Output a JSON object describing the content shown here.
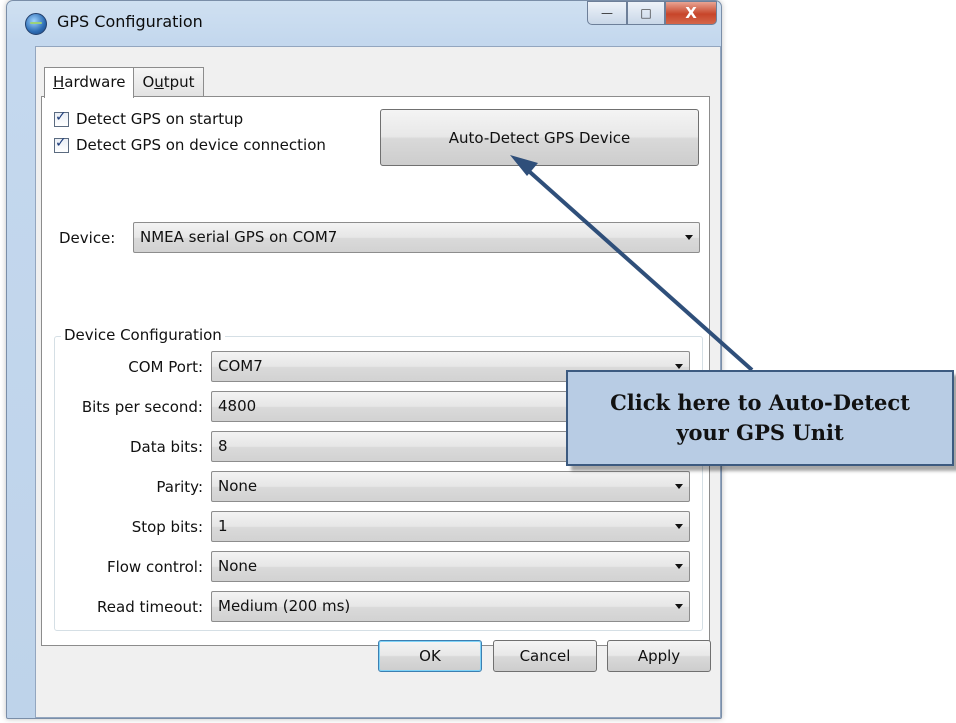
{
  "window": {
    "title": "GPS Configuration"
  },
  "window_buttons": {
    "minimize": "—",
    "maximize": "□",
    "close": "X"
  },
  "tabs": [
    {
      "label": "Hardware",
      "mnemonic_index": 0,
      "active": true
    },
    {
      "label": "Output",
      "mnemonic_index": 1,
      "active": false
    }
  ],
  "hardware": {
    "detect_startup": {
      "label": "Detect GPS on startup",
      "checked": true
    },
    "detect_connection": {
      "label": "Detect GPS on device connection",
      "checked": true
    },
    "auto_detect_button": "Auto-Detect GPS Device",
    "device": {
      "label": "Device:",
      "value": "NMEA serial GPS on COM7"
    },
    "group_title": "Device Configuration",
    "config_rows": [
      {
        "label": "COM Port:",
        "value": "COM7"
      },
      {
        "label": "Bits per second:",
        "value": "4800"
      },
      {
        "label": "Data bits:",
        "value": "8"
      },
      {
        "label": "Parity:",
        "value": "None"
      },
      {
        "label": "Stop bits:",
        "value": "1"
      },
      {
        "label": "Flow control:",
        "value": "None"
      },
      {
        "label": "Read timeout:",
        "value": "Medium (200 ms)"
      }
    ]
  },
  "footer": {
    "ok": "OK",
    "cancel": "Cancel",
    "apply": "Apply"
  },
  "callout": {
    "line1": "Click here to Auto-Detect",
    "line2": "your GPS Unit"
  },
  "colors": {
    "callout_fill": "#b8cce4",
    "callout_border": "#3c5a80",
    "arrow": "#2f4f7a"
  }
}
